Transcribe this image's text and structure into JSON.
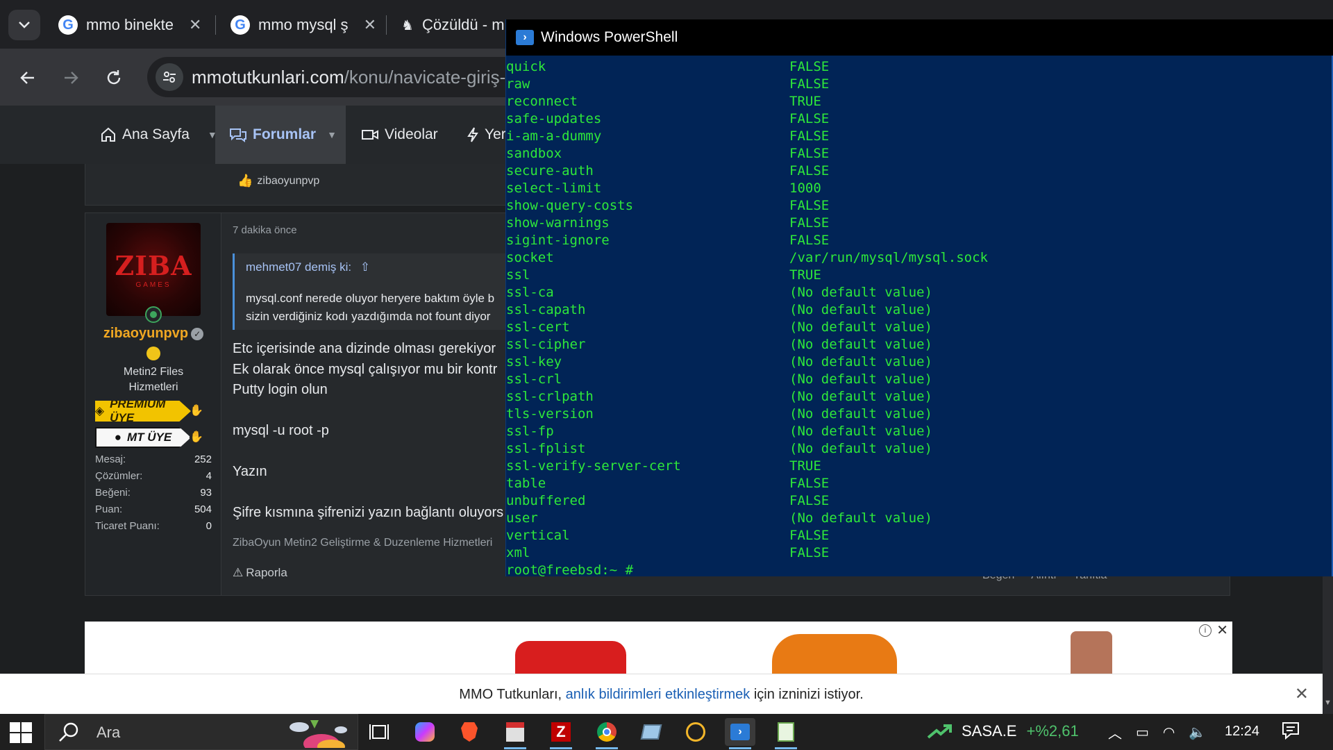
{
  "browser": {
    "tabs": [
      {
        "title": "mmo binekte"
      },
      {
        "title": "mmo mysql ş"
      },
      {
        "title": "Çözüldü - m"
      }
    ],
    "url_host": "mmotutkunlari.com",
    "url_path": "/konu/navicate-giriş-y"
  },
  "site_nav": {
    "home": "Ana Sayfa",
    "forums": "Forumlar",
    "videos": "Videolar",
    "new": "Yer"
  },
  "prev_post": {
    "liker": "zibaoyunpvp"
  },
  "post": {
    "time": "7 dakika önce",
    "quote_author": "mehmet07 demiş ki:",
    "quote_line1": "mysql.conf nerede oluyor heryere baktım öyle b",
    "quote_line2": "sizin verdiğiniz kodı yazdığımda not fount diyor",
    "lines": [
      "Etc içerisinde ana dizinde olması gerekiyor",
      "Ek olarak önce mysql çalışıyor mu bir kontr",
      "Putty login olun",
      "mysql -u root -p",
      "Yazın",
      "Şifre kısmına şifrenizi yazın bağlantı oluyors"
    ],
    "signature": "ZibaOyun Metin2 Geliştirme & Duzenleme Hizmetleri",
    "report": "Raporla",
    "actions": [
      "Beğen",
      "Alıntı",
      "Yanıtla"
    ]
  },
  "user": {
    "avatar_logo": "ZIBA",
    "avatar_sub": "GAMES",
    "name": "zibaoyunpvp",
    "title_line1": "Metin2 Files",
    "title_line2": "Hizmetleri",
    "badge_premium": "PREMIUM ÜYE",
    "badge_mt": "MT ÜYE",
    "stats": [
      {
        "label": "Mesaj:",
        "value": "252"
      },
      {
        "label": "Çözümler:",
        "value": "4"
      },
      {
        "label": "Beğeni:",
        "value": "93"
      },
      {
        "label": "Puan:",
        "value": "504"
      },
      {
        "label": "Ticaret Puanı:",
        "value": "0"
      }
    ]
  },
  "notification": {
    "prefix": "MMO Tutkunları,",
    "link": "anlık bildirimleri etkinleştirmek",
    "suffix": "için izninizi istiyor."
  },
  "powershell": {
    "title": "Windows PowerShell",
    "rows": [
      [
        "quick",
        "FALSE"
      ],
      [
        "raw",
        "FALSE"
      ],
      [
        "reconnect",
        "TRUE"
      ],
      [
        "safe-updates",
        "FALSE"
      ],
      [
        "i-am-a-dummy",
        "FALSE"
      ],
      [
        "sandbox",
        "FALSE"
      ],
      [
        "secure-auth",
        "FALSE"
      ],
      [
        "select-limit",
        "1000"
      ],
      [
        "show-query-costs",
        "FALSE"
      ],
      [
        "show-warnings",
        "FALSE"
      ],
      [
        "sigint-ignore",
        "FALSE"
      ],
      [
        "socket",
        "/var/run/mysql/mysql.sock"
      ],
      [
        "ssl",
        "TRUE"
      ],
      [
        "ssl-ca",
        "(No default value)"
      ],
      [
        "ssl-capath",
        "(No default value)"
      ],
      [
        "ssl-cert",
        "(No default value)"
      ],
      [
        "ssl-cipher",
        "(No default value)"
      ],
      [
        "ssl-key",
        "(No default value)"
      ],
      [
        "ssl-crl",
        "(No default value)"
      ],
      [
        "ssl-crlpath",
        "(No default value)"
      ],
      [
        "tls-version",
        "(No default value)"
      ],
      [
        "ssl-fp",
        "(No default value)"
      ],
      [
        "ssl-fplist",
        "(No default value)"
      ],
      [
        "ssl-verify-server-cert",
        "TRUE"
      ],
      [
        "table",
        "FALSE"
      ],
      [
        "unbuffered",
        "FALSE"
      ],
      [
        "user",
        "(No default value)"
      ],
      [
        "vertical",
        "FALSE"
      ],
      [
        "xml",
        "FALSE"
      ]
    ],
    "prompt": "root@freebsd:~ #"
  },
  "taskbar": {
    "search_placeholder": "Ara",
    "ticker_symbol": "SASA.E",
    "ticker_change": "+%2,61",
    "clock": "12:24"
  },
  "colors": {
    "ps_background": "#012456",
    "ps_text": "#2ee83a",
    "username": "#f0a722",
    "link": "#1a5fb4",
    "ticker_up": "#4fc26c"
  }
}
